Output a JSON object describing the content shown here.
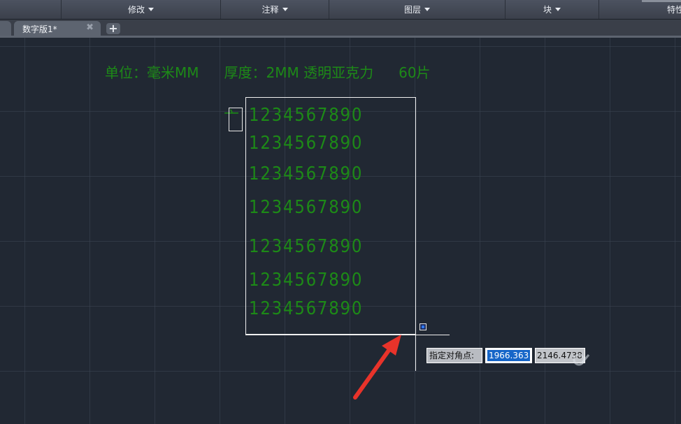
{
  "ribbon": {
    "panels": [
      {
        "label": "",
        "has_caret": false
      },
      {
        "label": "修改",
        "has_caret": true
      },
      {
        "label": "注释",
        "has_caret": true
      },
      {
        "label": "图层",
        "has_caret": true
      },
      {
        "label": "块",
        "has_caret": true
      },
      {
        "label": "特性",
        "has_caret": false
      }
    ]
  },
  "tabs": {
    "active_label": "数字版1*",
    "close_glyph": "✖",
    "add_glyph": "+"
  },
  "drawing": {
    "units_label": "单位：毫米MM",
    "thickness_label": "厚度：2MM 透明亚克力",
    "count_label": "60片",
    "digit_row_text": "1234567890",
    "digit_rows": 7,
    "partial_glyph": "亠",
    "text_color": "#1d8a17"
  },
  "command": {
    "prompt_label": "指定对角点:",
    "coord_x": "1966.363",
    "coord_y": "2146.4738"
  },
  "colors": {
    "canvas_bg": "#212833",
    "arrow": "#e8332a",
    "selection": "#f0f0f0"
  }
}
